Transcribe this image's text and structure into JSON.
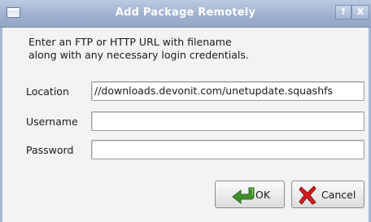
{
  "window": {
    "title": "Add Package Remotely",
    "up_glyph": "↑",
    "close_glyph": "X"
  },
  "instructions": {
    "line1": "Enter an FTP or HTTP URL with filename",
    "line2": "along with any necessary login credentials."
  },
  "form": {
    "location": {
      "label": "Location",
      "value": "//downloads.devonit.com/unetupdate.squashfs"
    },
    "username": {
      "label": "Username",
      "value": ""
    },
    "password": {
      "label": "Password",
      "value": ""
    }
  },
  "buttons": {
    "ok": {
      "label": "OK",
      "icon": "green-arrow-icon"
    },
    "cancel": {
      "label": "Cancel",
      "icon": "red-x-icon"
    }
  },
  "colors": {
    "titlebar": "#9fb1cf",
    "window_bg": "#f3f3f2",
    "ok_icon": "#3f8f2a",
    "cancel_icon": "#d11f1f"
  }
}
